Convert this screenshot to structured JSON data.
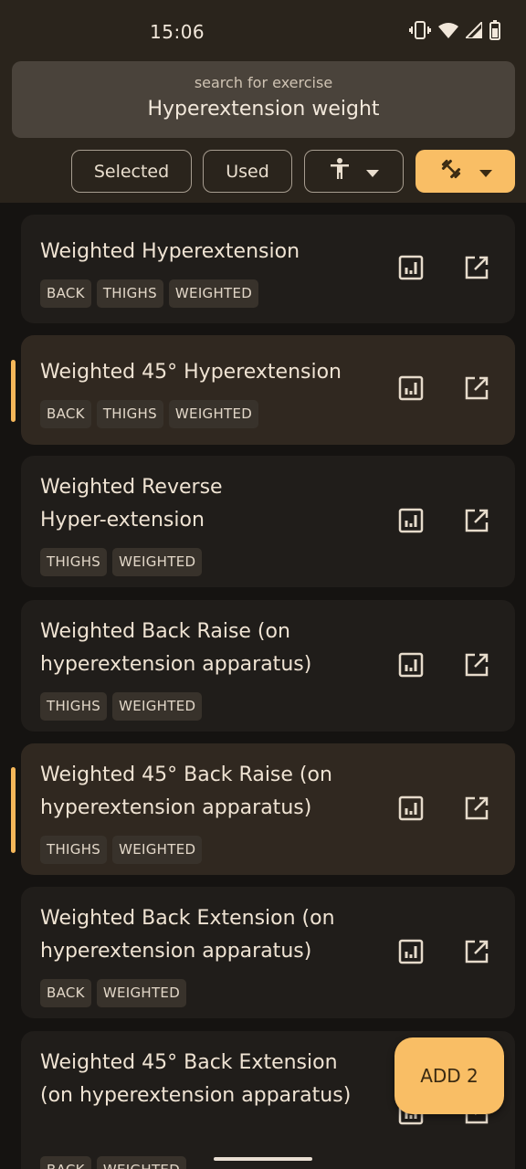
{
  "status_bar": {
    "time": "15:06"
  },
  "search": {
    "label": "search for exercise",
    "value": "Hyperextension weight"
  },
  "filters": {
    "selected_label": "Selected",
    "used_label": "Used",
    "body_filter_icon": "person-icon",
    "equipment_filter_icon": "dumbbell-icon"
  },
  "exercises": [
    {
      "title": "Weighted Hyperextension",
      "tags": [
        "BACK",
        "THIGHS",
        "WEIGHTED"
      ],
      "selected": false
    },
    {
      "title": "Weighted 45° Hyperextension",
      "tags": [
        "BACK",
        "THIGHS",
        "WEIGHTED"
      ],
      "selected": true
    },
    {
      "title": "Weighted Reverse Hyper-extension",
      "tags": [
        "THIGHS",
        "WEIGHTED"
      ],
      "selected": false
    },
    {
      "title": "Weighted Back Raise (on hyperextension apparatus)",
      "tags": [
        "THIGHS",
        "WEIGHTED"
      ],
      "selected": false
    },
    {
      "title": "Weighted 45° Back Raise (on hyperextension apparatus)",
      "tags": [
        "THIGHS",
        "WEIGHTED"
      ],
      "selected": true
    },
    {
      "title": "Weighted Back Extension (on hyperextension apparatus)",
      "tags": [
        "BACK",
        "WEIGHTED"
      ],
      "selected": false
    },
    {
      "title": "Weighted 45° Back Extension (on hyperextension apparatus)",
      "tags": [
        "BACK",
        "WEIGHTED"
      ],
      "selected": false
    }
  ],
  "fab": {
    "label": "ADD 2"
  },
  "colors": {
    "accent": "#F9BE65",
    "background": "#151311",
    "card": "#201D1A",
    "card_selected": "#302820"
  }
}
